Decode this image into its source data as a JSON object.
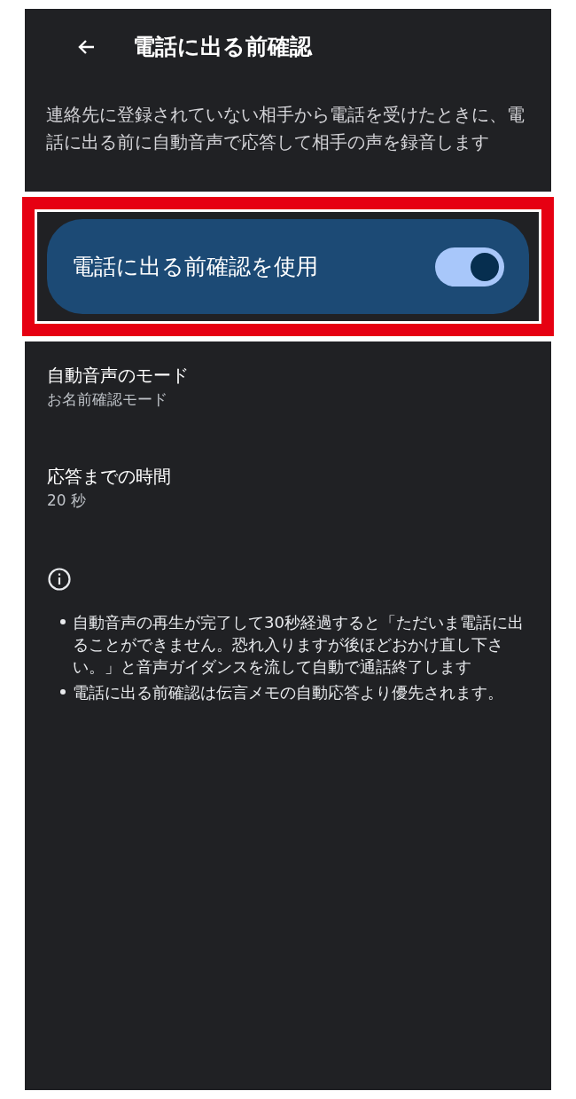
{
  "header": {
    "title": "電話に出る前確認"
  },
  "description": "連絡先に登録されていない相手から電話を受けたときに、電話に出る前に自動音声で応答して相手の声を録音します",
  "main_toggle": {
    "label": "電話に出る前確認を使用",
    "on": true
  },
  "settings": [
    {
      "title": "自動音声のモード",
      "value": "お名前確認モード"
    },
    {
      "title": "応答までの時間",
      "value": "20 秒"
    }
  ],
  "notes": [
    "自動音声の再生が完了して30秒経過すると「ただいま電話に出ることができません。恐れ入りますが後ほどおかけ直し下さい。」と音声ガイダンスを流して自動で通話終了します",
    "電話に出る前確認は伝言メモの自動応答より優先されます。"
  ]
}
